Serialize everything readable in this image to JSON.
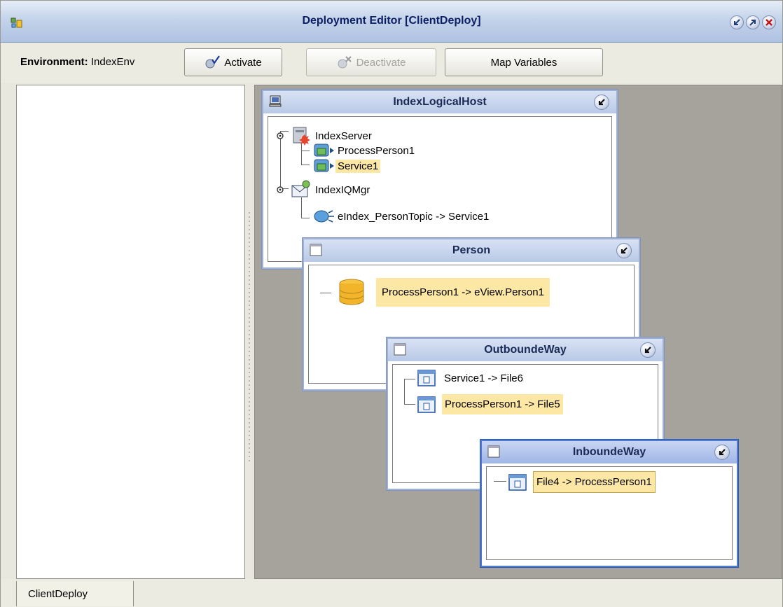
{
  "window": {
    "title": "Deployment Editor [ClientDeploy]",
    "title_color": "#0c1f64"
  },
  "toolbar": {
    "env_label": "Environment:",
    "env_value": "IndexEnv",
    "activate_label": "Activate",
    "deactivate_label": "Deactivate",
    "map_variables_label": "Map Variables"
  },
  "frames": {
    "logical_host": {
      "title": "IndexLogicalHost",
      "items": {
        "server": "IndexServer",
        "process_person": "ProcessPerson1",
        "service": "Service1",
        "iqmgr": "IndexIQMgr",
        "topic": "eIndex_PersonTopic -> Service1"
      }
    },
    "person": {
      "title": "Person",
      "item": "ProcessPerson1 -> eView.Person1"
    },
    "outbound": {
      "title": "OutboundeWay",
      "items": [
        "Service1 -> File6",
        "ProcessPerson1 -> File5"
      ]
    },
    "inbound": {
      "title": "InboundeWay",
      "item": "File4 -> ProcessPerson1"
    }
  },
  "tabs": {
    "active": "ClientDeploy"
  },
  "colors": {
    "highlight": "#fde7a4",
    "canvas": "#a5a39b",
    "frame_border": "#9fb2d6",
    "active_frame_border": "#4f7bd2"
  }
}
